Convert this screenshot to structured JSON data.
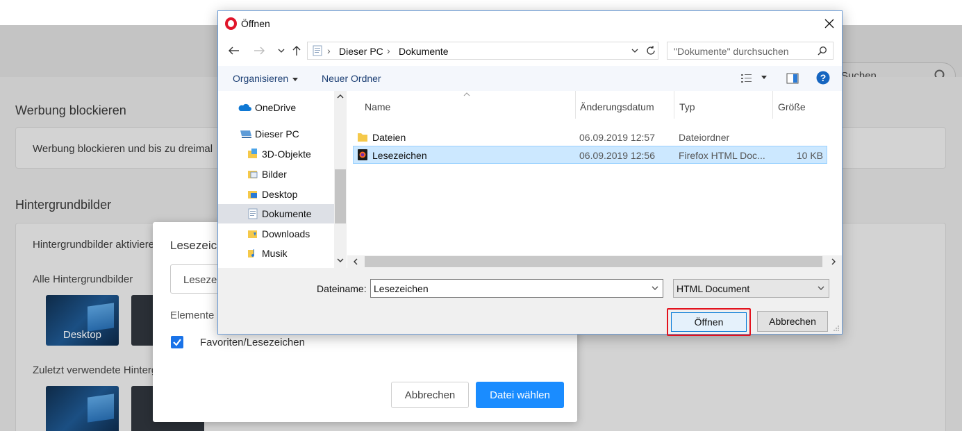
{
  "background": {
    "search_placeholder": "Suchen",
    "section_ad": "Werbung blockieren",
    "ad_card_text": "Werbung blockieren und bis zu dreimal",
    "section_wallpapers": "Hintergrundbilder",
    "wallpapers_card_text": "Hintergrundbilder aktivieren",
    "all_wallpapers": "Alle Hintergrundbilder",
    "recent_wallpapers": "Zuletzt verwendete Hintergrundbilder",
    "thumb_desktop_label": "Desktop"
  },
  "import_dialog": {
    "title": "Lesezeichen importieren",
    "select_value": "Lesezeichen",
    "items_heading": "Elemente",
    "checkbox_label": "Favoriten/Lesezeichen",
    "cancel_label": "Abbrechen",
    "choose_label": "Datei wählen",
    "accent_color": "#1a8cff"
  },
  "file_dialog": {
    "title": "Öffnen",
    "address": {
      "segments": [
        "Dieser PC",
        "Dokumente"
      ]
    },
    "search_placeholder": "\"Dokumente\" durchsuchen",
    "toolbar": {
      "organize": "Organisieren",
      "new_folder": "Neuer Ordner"
    },
    "tree": [
      {
        "label": "OneDrive",
        "icon": "onedrive-icon"
      },
      {
        "label": "Dieser PC",
        "icon": "computer-icon"
      },
      {
        "label": "3D-Objekte",
        "icon": "3d-objects-icon"
      },
      {
        "label": "Bilder",
        "icon": "pictures-folder-icon"
      },
      {
        "label": "Desktop",
        "icon": "desktop-folder-icon"
      },
      {
        "label": "Dokumente",
        "icon": "documents-folder-icon",
        "selected": true
      },
      {
        "label": "Downloads",
        "icon": "downloads-folder-icon"
      },
      {
        "label": "Musik",
        "icon": "music-folder-icon"
      }
    ],
    "columns": {
      "name": "Name",
      "date": "Änderungsdatum",
      "type": "Typ",
      "size": "Größe"
    },
    "files": [
      {
        "name": "Dateien",
        "date": "06.09.2019 12:57",
        "type": "Dateiordner",
        "size": "",
        "icon": "folder-icon",
        "selected": false
      },
      {
        "name": "Lesezeichen",
        "date": "06.09.2019 12:56",
        "type": "Firefox HTML Doc...",
        "size": "10 KB",
        "icon": "firefox-html-file-icon",
        "selected": true
      }
    ],
    "filename_label": "Dateiname:",
    "filename_value": "Lesezeichen",
    "filetype_value": "HTML Document",
    "open_label": "Öffnen",
    "cancel_label": "Abbrechen",
    "highlight_color": "#e3121d"
  }
}
